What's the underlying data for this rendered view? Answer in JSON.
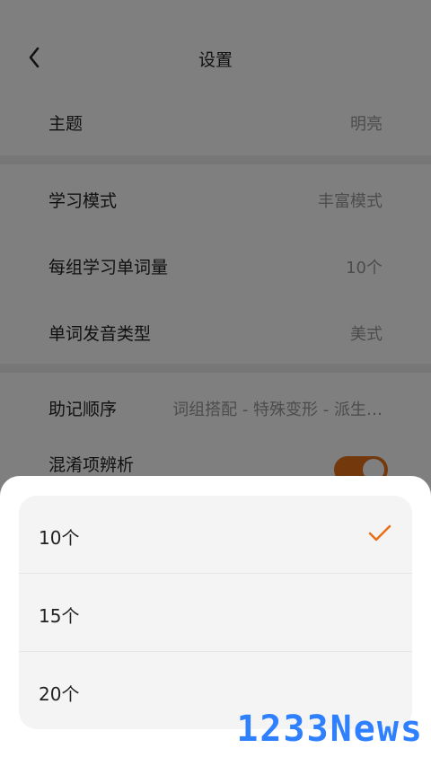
{
  "header": {
    "title": "设置",
    "back_icon": "chevron-left-icon"
  },
  "groups": [
    {
      "rows": [
        {
          "label": "主题",
          "value": "明亮"
        }
      ]
    },
    {
      "rows": [
        {
          "label": "学习模式",
          "value": "丰富模式"
        },
        {
          "label": "每组学习单词量",
          "value": "10个"
        },
        {
          "label": "单词发音类型",
          "value": "美式"
        }
      ]
    },
    {
      "rows": [
        {
          "label": "助记顺序",
          "value": "词组搭配 - 特殊变形 - 派生…"
        },
        {
          "label": "混淆项辨析",
          "toggle_on": true
        }
      ]
    }
  ],
  "sheet": {
    "options": [
      {
        "label": "10个",
        "selected": true
      },
      {
        "label": "15个",
        "selected": false
      },
      {
        "label": "20个",
        "selected": false
      }
    ],
    "check_icon": "checkmark-icon"
  },
  "watermark": "1233News",
  "colors": {
    "accent": "#e8701a",
    "watermark": "#2f80ff",
    "overlay": "rgba(0,0,0,0.5)"
  }
}
